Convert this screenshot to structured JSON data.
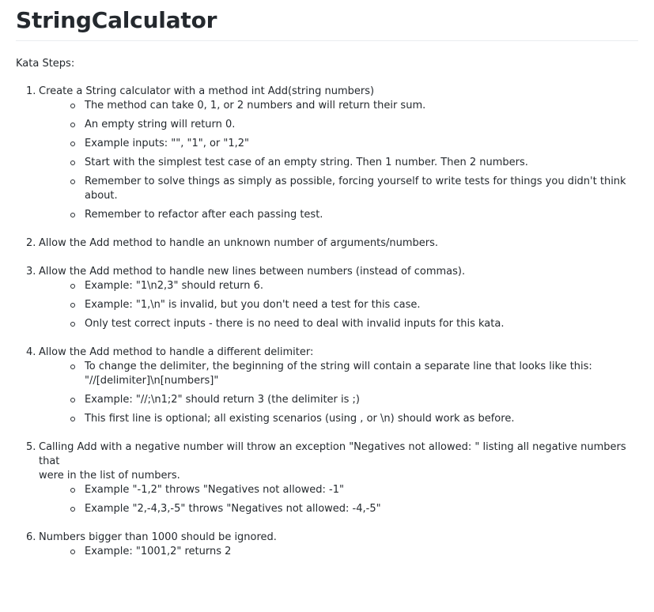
{
  "title": "StringCalculator",
  "intro": "Kata Steps:",
  "steps": [
    {
      "num": "1.",
      "text": "Create a String calculator with a method int Add(string numbers)",
      "items": [
        "The method can take 0, 1, or 2 numbers and will return their sum.",
        "An empty string will return 0.",
        "Example inputs: \"\", \"1\", or \"1,2\"",
        "Start with the simplest test case of an empty string. Then 1 number. Then 2 numbers.",
        "Remember to solve things as simply as possible, forcing yourself to write tests for things you didn't think about.",
        "Remember to refactor after each passing test."
      ]
    },
    {
      "num": "2.",
      "text": "Allow the Add method to handle an unknown number of arguments/numbers."
    },
    {
      "num": "3.",
      "text": "Allow the Add method to handle new lines between numbers (instead of commas).",
      "items": [
        "Example: \"1\\n2,3\" should return 6.",
        "Example: \"1,\\n\" is invalid, but you don't need a test for this case.",
        "Only test correct inputs - there is no need to deal with invalid inputs for this kata."
      ]
    },
    {
      "num": "4.",
      "text": "Allow the Add method to handle a different delimiter:",
      "items": [
        "To change the delimiter, the beginning of the string will contain a separate line that looks like this:",
        "\"//[delimiter]\\n[numbers]\"",
        "Example: \"//;\\n1;2\" should return 3 (the delimiter is ;)",
        "This first line is optional; all existing scenarios (using , or \\n) should work as before."
      ]
    },
    {
      "num": "5.",
      "text_line1": "Calling Add with a negative number will throw an exception \"Negatives not allowed: \" listing all negative numbers that",
      "text_line2": "were in the list of numbers.",
      "items": [
        "Example \"-1,2\" throws \"Negatives not allowed: -1\"",
        "Example \"2,-4,3,-5\" throws \"Negatives not allowed: -4,-5\""
      ]
    },
    {
      "num": "6.",
      "text": "Numbers bigger than 1000 should be ignored.",
      "items": [
        "Example: \"1001,2\" returns 2"
      ]
    }
  ]
}
